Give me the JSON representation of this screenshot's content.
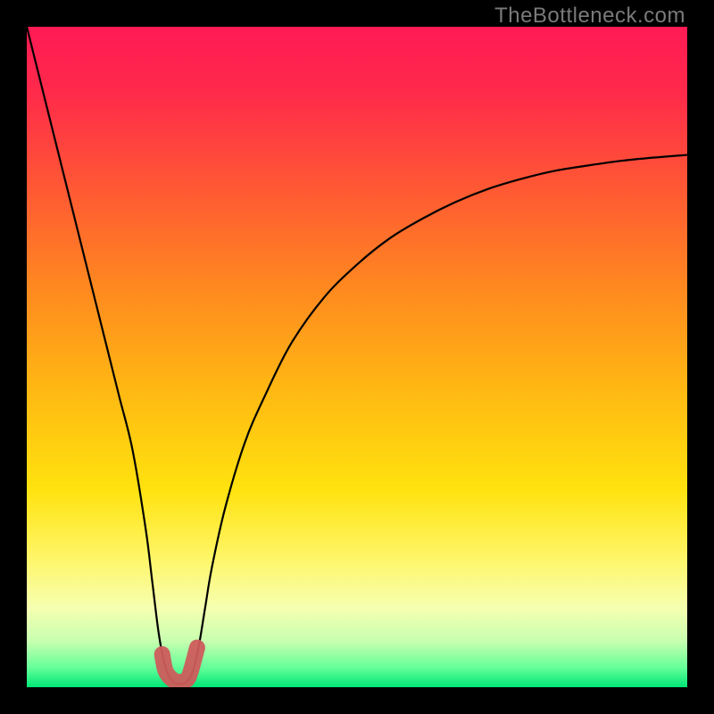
{
  "watermark": "TheBottleneck.com",
  "chart_data": {
    "type": "line",
    "title": "",
    "xlabel": "",
    "ylabel": "",
    "xlim": [
      0,
      100
    ],
    "ylim": [
      0,
      100
    ],
    "grid": false,
    "series": [
      {
        "name": "bottleneck-curve",
        "x": [
          0,
          2,
          4,
          6,
          8,
          10,
          12,
          14,
          16,
          18,
          19,
          20,
          21,
          22,
          23,
          24,
          25,
          26,
          27,
          28,
          30,
          33,
          36,
          40,
          45,
          50,
          55,
          60,
          65,
          70,
          75,
          80,
          85,
          90,
          95,
          100
        ],
        "values": [
          100,
          92,
          84,
          76,
          68,
          60,
          52,
          44,
          36,
          24,
          16,
          8,
          3,
          1,
          0.5,
          0.7,
          2,
          6,
          12,
          18,
          27,
          37,
          44,
          52,
          59,
          64,
          68,
          71,
          73.5,
          75.5,
          77,
          78.2,
          79,
          79.7,
          80.2,
          80.6
        ]
      }
    ],
    "highlight": {
      "name": "minimum-band",
      "x": [
        20.5,
        21,
        22,
        23,
        24,
        24.5,
        25,
        25.8
      ],
      "values": [
        5,
        2.5,
        1.2,
        0.8,
        1.0,
        1.5,
        3,
        6
      ]
    },
    "background_gradient": {
      "stops": [
        {
          "pos": 0.0,
          "color": "#ff1a55"
        },
        {
          "pos": 0.1,
          "color": "#ff2a4a"
        },
        {
          "pos": 0.25,
          "color": "#ff5a33"
        },
        {
          "pos": 0.4,
          "color": "#ff8a1f"
        },
        {
          "pos": 0.55,
          "color": "#ffb813"
        },
        {
          "pos": 0.7,
          "color": "#ffe20e"
        },
        {
          "pos": 0.8,
          "color": "#fff564"
        },
        {
          "pos": 0.88,
          "color": "#f6ffb0"
        },
        {
          "pos": 0.93,
          "color": "#c8ffb0"
        },
        {
          "pos": 0.97,
          "color": "#66ff99"
        },
        {
          "pos": 1.0,
          "color": "#00e676"
        }
      ]
    }
  }
}
